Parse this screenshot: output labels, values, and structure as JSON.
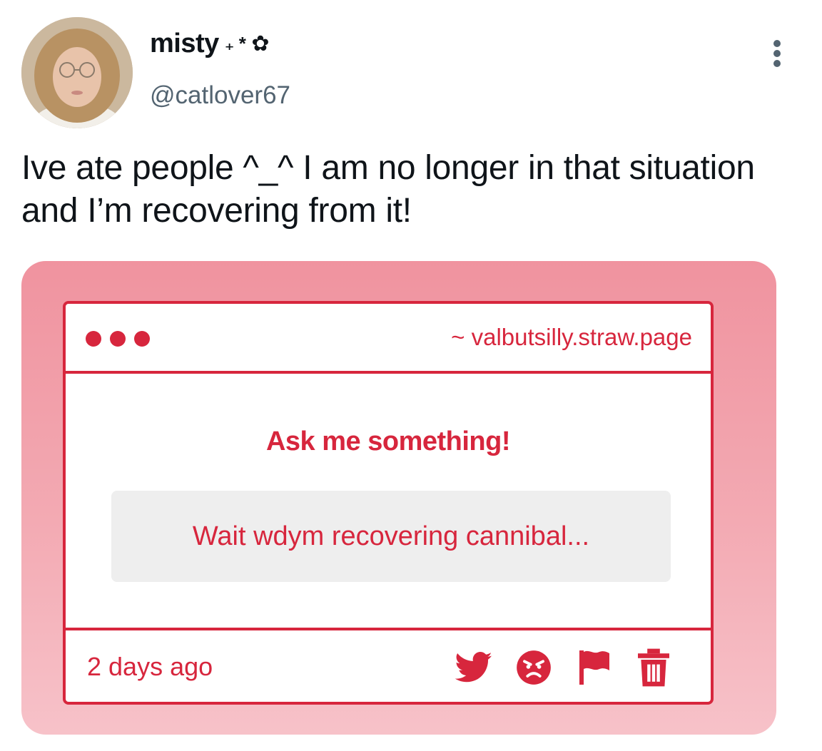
{
  "tweet": {
    "author": {
      "display_name": "misty",
      "name_decor": "₊ *",
      "name_flower": "✿",
      "handle": "@catlover67"
    },
    "text": "Ive ate people ^_^ I am no longer in that situation and I’m recovering from it!",
    "menu_icon": "more-vertical-icon"
  },
  "card": {
    "url": "~ valbutsilly.straw.page",
    "heading": "Ask me something!",
    "question": "Wait wdym recovering cannibal...",
    "time": "2 days ago",
    "actions": [
      "twitter-bird-icon",
      "angry-face-icon",
      "flag-icon",
      "trash-icon"
    ],
    "colors": {
      "accent": "#d7263d",
      "card_bg": "#f0939f",
      "question_bg": "#eeeeee"
    }
  }
}
